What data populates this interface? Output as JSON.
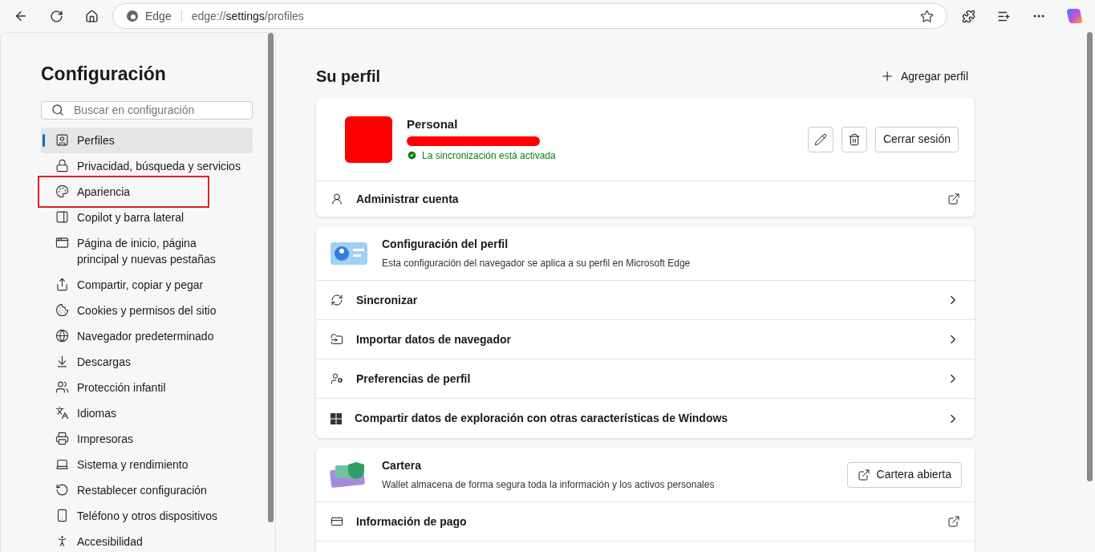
{
  "toolbar": {
    "site_label": "Edge",
    "url_prefix": "edge://",
    "url_bold": "settings",
    "url_suffix": "/profiles"
  },
  "sidebar": {
    "title": "Configuración",
    "search": {
      "placeholder": "Buscar en configuración"
    },
    "items": [
      {
        "label": "Perfiles",
        "selected": true,
        "annotated": false
      },
      {
        "label": "Privacidad, búsqueda y servicios",
        "selected": false,
        "annotated": false
      },
      {
        "label": "Apariencia",
        "selected": false,
        "annotated": true
      },
      {
        "label": "Copilot y barra lateral",
        "selected": false,
        "annotated": false
      },
      {
        "label": "Página de inicio, página principal y nuevas pestañas",
        "selected": false,
        "annotated": false
      },
      {
        "label": "Compartir, copiar y pegar",
        "selected": false,
        "annotated": false
      },
      {
        "label": "Cookies y permisos del sitio",
        "selected": false,
        "annotated": false
      },
      {
        "label": "Navegador predeterminado",
        "selected": false,
        "annotated": false
      },
      {
        "label": "Descargas",
        "selected": false,
        "annotated": false
      },
      {
        "label": "Protección infantil",
        "selected": false,
        "annotated": false
      },
      {
        "label": "Idiomas",
        "selected": false,
        "annotated": false
      },
      {
        "label": "Impresoras",
        "selected": false,
        "annotated": false
      },
      {
        "label": "Sistema y rendimiento",
        "selected": false,
        "annotated": false
      },
      {
        "label": "Restablecer configuración",
        "selected": false,
        "annotated": false
      },
      {
        "label": "Teléfono y otros dispositivos",
        "selected": false,
        "annotated": false
      },
      {
        "label": "Accesibilidad",
        "selected": false,
        "annotated": false
      }
    ]
  },
  "main": {
    "title": "Su perfil",
    "add_button": "Agregar perfil",
    "profile": {
      "name": "Personal",
      "sync_status": "La sincronización está activada",
      "synced": true,
      "sign_out": "Cerrar sesión",
      "manage": "Administrar cuenta"
    },
    "settings_card": {
      "title": "Configuración del perfil",
      "description": "Esta configuración del navegador se aplica a su perfil en Microsoft Edge",
      "rows": [
        {
          "label": "Sincronizar",
          "kind": "chevron"
        },
        {
          "label": "Importar datos de navegador",
          "kind": "chevron"
        },
        {
          "label": "Preferencias de perfil",
          "kind": "chevron"
        },
        {
          "label": "Compartir datos de exploración con otras características de Windows",
          "kind": "chevron"
        }
      ]
    },
    "wallet_card": {
      "title": "Cartera",
      "description": "Wallet almacena de forma segura toda la información y los activos personales",
      "button": "Cartera abierta",
      "rows": [
        {
          "label": "Información de pago",
          "kind": "external"
        }
      ]
    }
  }
}
